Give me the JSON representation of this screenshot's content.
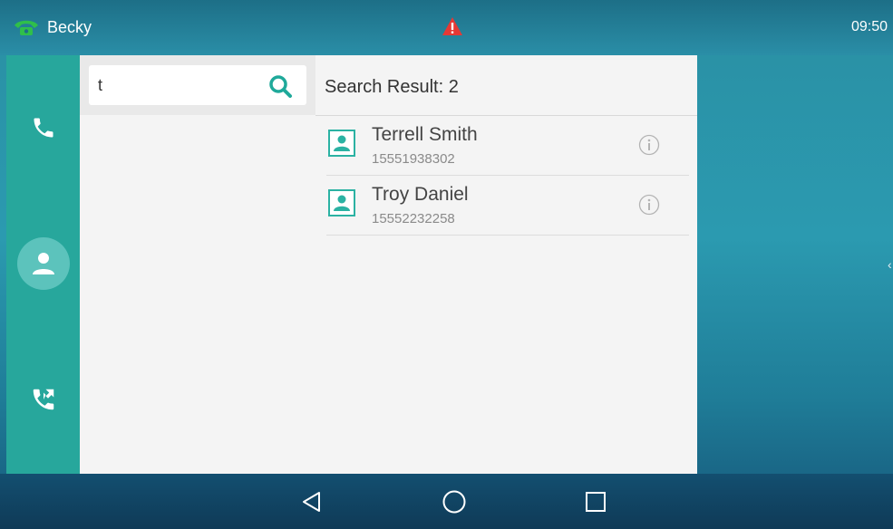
{
  "status_bar": {
    "line_name": "Becky",
    "clock": "09:50",
    "line_icon": "phone-handset-icon",
    "line_icon_color": "#2fbf4a",
    "alert_icon": "warning-triangle-icon",
    "alert_color": "#e53935"
  },
  "left_rail": {
    "items": [
      {
        "icon": "phone-icon",
        "label": "Calls"
      },
      {
        "icon": "contacts-icon",
        "label": "Directory",
        "selected": true
      },
      {
        "icon": "call-transfer-icon",
        "label": "History"
      }
    ]
  },
  "search": {
    "value": "t",
    "icon": "search-icon",
    "accent": "#1fa99a"
  },
  "results": {
    "header": "Search Result: 2",
    "items": [
      {
        "name": "Terrell Smith",
        "number": "15551938302"
      },
      {
        "name": "Troy Daniel",
        "number": "15552232258"
      }
    ]
  },
  "nav_bar": {
    "back_icon": "back-triangle-icon",
    "home_icon": "home-circle-icon",
    "recent_icon": "recents-square-icon"
  }
}
